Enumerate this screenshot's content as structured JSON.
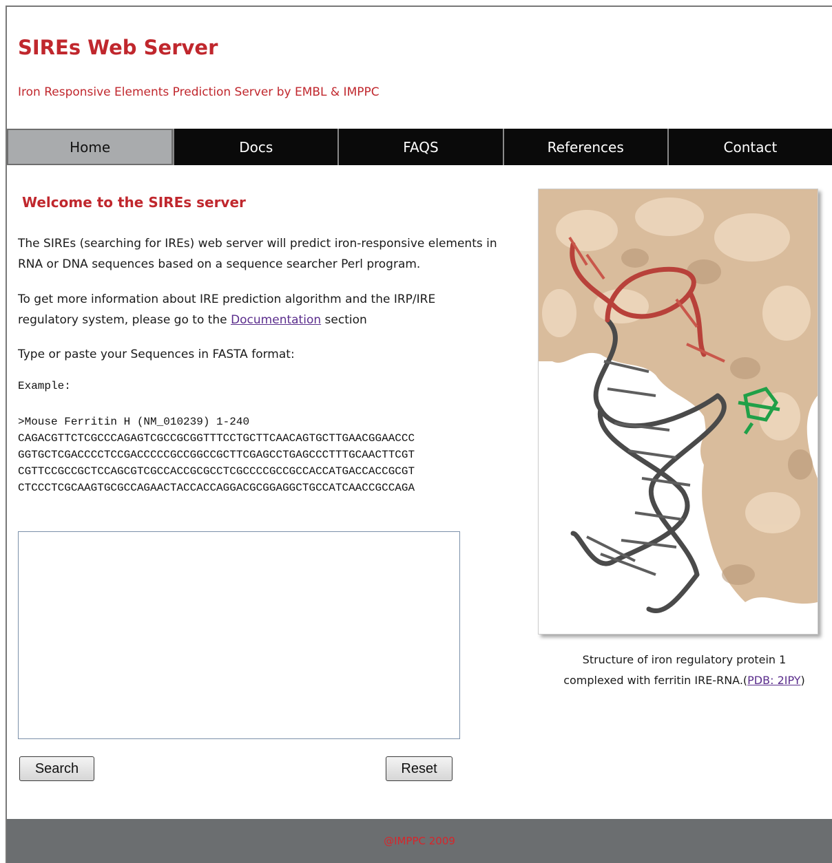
{
  "header": {
    "title": "SIREs Web Server",
    "subtitle": "Iron Responsive Elements Prediction Server by EMBL & IMPPC"
  },
  "nav": {
    "items": [
      {
        "label": "Home",
        "active": true
      },
      {
        "label": "Docs",
        "active": false
      },
      {
        "label": "FAQS",
        "active": false
      },
      {
        "label": "References",
        "active": false
      },
      {
        "label": "Contact",
        "active": false
      }
    ]
  },
  "main": {
    "heading": "Welcome to the SIREs server",
    "intro_line1": "The SIREs (searching for IREs) web server will predict iron-responsive elements in",
    "intro_line2": "RNA or DNA sequences based on a sequence searcher Perl program.",
    "info_line1": "To get more information about IRE prediction algorithm and the IRP/IRE",
    "info_line2_prefix": "regulatory system, please go to the",
    "info_link": "Documentation",
    "info_line2_suffix": "section",
    "instruction": "Type or paste your Sequences in FASTA format:",
    "example_label": "Example:",
    "example_header": ">Mouse Ferritin H (NM_010239) 1-240",
    "example_lines": [
      "CAGACGTTCTCGCCCAGAGTCGCCGCGGTTTCCTGCTTCAACAGTGCTTGAACGGAACCC",
      "GGTGCTCGACCCCTCCGACCCCCGCCGGCCGCTTCGAGCCTGAGCCCTTTGCAACTTCGT",
      "CGTTCCGCCGCTCCAGCGTCGCCACCGCGCCTCGCCCCGCCGCCACCATGACCACCGCGT",
      "CTCCCTCGCAAGTGCGCCAGAACTACCACCAGGACGCGGAGGCTGCCATCAACCGCCAGA"
    ],
    "sequence_input_value": "",
    "search_label": "Search",
    "reset_label": "Reset"
  },
  "figure": {
    "caption_line1": "Structure of iron regulatory protein 1",
    "caption_line2": "complexed with ferritin IRE-RNA.(",
    "caption_link": "PDB: 2IPY",
    "caption_end": ")"
  },
  "footer": {
    "text": "@IMPPC 2009"
  },
  "colors": {
    "brand_red": "#c0272d",
    "nav_bg": "#0a0a0a",
    "nav_active": "#a9abad",
    "footer_bg": "#6b6e70"
  }
}
